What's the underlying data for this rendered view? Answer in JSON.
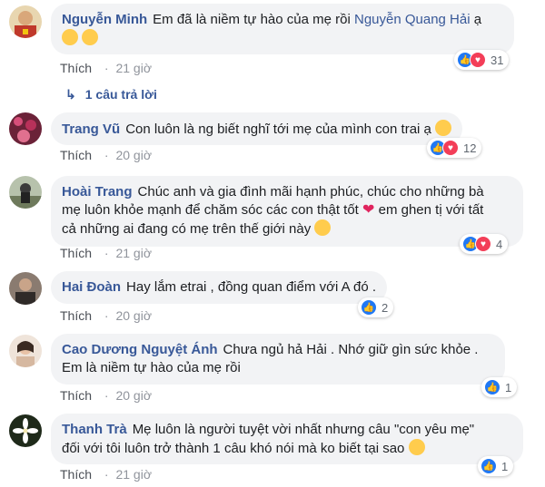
{
  "comments": [
    {
      "author": "Nguyễn Minh",
      "text": "Em đã là niềm tự hào của mẹ rồi",
      "mention": "Nguyễn Quang Hải",
      "suffix": "ạ",
      "emoji": "grinning-sweat-emoji",
      "like_label": "Thích",
      "time": "21 giờ",
      "reaction_count": "31",
      "reply_label": "1 câu trả lời",
      "accent": "#c0392b"
    },
    {
      "author": "Trang Vũ",
      "text": "Con luôn là ng biết nghĩ tới mẹ của mình con trai ạ",
      "like_label": "Thích",
      "time": "20 giờ",
      "reaction_count": "12",
      "accent": "#8e2d4a"
    },
    {
      "author": "Hoài Trang",
      "line1": "Chúc anh và gia đình mãi hạnh phúc, chúc cho những bà",
      "line2a": "mẹ luôn khỏe mạnh để chăm sóc các con thật tốt",
      "line2b": "em ghen tị với tất",
      "line3": "cả những ai đang có mẹ trên thế giới này",
      "like_label": "Thích",
      "time": "21 giờ",
      "reaction_count": "4",
      "accent": "#5b6b4a"
    },
    {
      "author": "Hai Đoàn",
      "text": "Hay lắm etrai , đồng quan điểm với A đó .",
      "like_label": "Thích",
      "time": "20 giờ",
      "reaction_count": "2",
      "accent": "#6b5a52"
    },
    {
      "author": "Cao Dương Nguyệt Ánh",
      "line1": "Chưa ngủ hả Hải . Nhớ giữ gìn sức khỏe .",
      "line2": "Em là niềm tự hào của mẹ rồi",
      "like_label": "Thích",
      "time": "20 giờ",
      "reaction_count": "1",
      "accent": "#c9a58c"
    },
    {
      "author": "Thanh Trà",
      "line1": "Mẹ luôn là người tuyệt vời nhất nhưng câu \"con yêu mẹ\"",
      "line2": "đối với tôi luôn trở thành 1 câu khó nói mà ko biết tại sao",
      "like_label": "Thích",
      "time": "21 giờ",
      "reaction_count": "1",
      "accent": "#1f2a1a"
    }
  ],
  "colors": {
    "link": "#385898",
    "like": "#2078f4",
    "love": "#f33e58",
    "bubble": "#f2f3f5"
  }
}
